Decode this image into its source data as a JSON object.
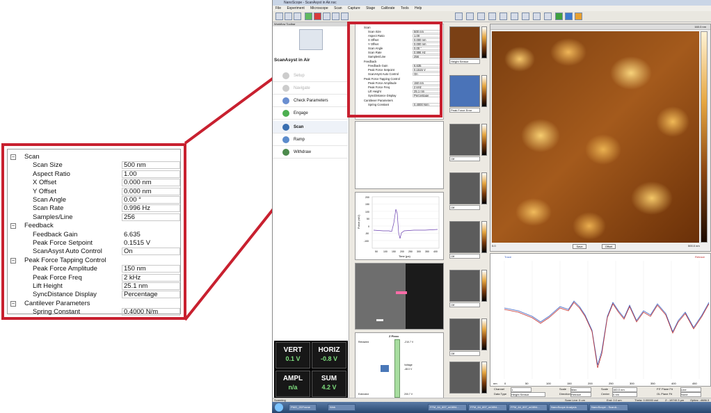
{
  "app": {
    "title": "NanoScope - ScanAsyst in Air.nsc",
    "menu": [
      "File",
      "Experiment",
      "Microscope",
      "Scan",
      "Capture",
      "Stage",
      "Calibrate",
      "Tools",
      "Help"
    ],
    "status": "Scanning"
  },
  "workflow": {
    "header": "Workflow Toolbar",
    "mode": "ScanAsyst in Air",
    "steps": [
      "Setup",
      "Navigate",
      "Check Parameters",
      "Engage",
      "Scan",
      "Ramp",
      "Withdraw"
    ]
  },
  "meters": {
    "vert": {
      "name": "VERT",
      "value": "0.1 V"
    },
    "horiz": {
      "name": "HORIZ",
      "value": "-0.8 V"
    },
    "ampl": {
      "name": "AMPL",
      "value": "n/a"
    },
    "sum": {
      "name": "SUM",
      "value": "4.2 V"
    }
  },
  "params": {
    "scan": {
      "title": "Scan",
      "scan_size": {
        "label": "Scan Size",
        "value": "500 nm"
      },
      "aspect_ratio": {
        "label": "Aspect Ratio",
        "value": "1.00"
      },
      "x_offset": {
        "label": "X Offset",
        "value": "0.000 nm"
      },
      "y_offset": {
        "label": "Y Offset",
        "value": "0.000 nm"
      },
      "scan_angle": {
        "label": "Scan Angle",
        "value": "0.00 °"
      },
      "scan_rate": {
        "label": "Scan Rate",
        "value": "0.996 Hz"
      },
      "samples_line": {
        "label": "Samples/Line",
        "value": "256"
      }
    },
    "feedback": {
      "title": "Feedback",
      "feedback_gain": {
        "label": "Feedback Gain",
        "value": "6.635"
      },
      "peak_force_setpoint": {
        "label": "Peak Force Setpoint",
        "value": "0.1515 V"
      },
      "scanasyst_auto": {
        "label": "ScanAsyst Auto Control",
        "value": "On"
      }
    },
    "pftc": {
      "title": "Peak Force Tapping Control",
      "amplitude": {
        "label": "Peak Force Amplitude",
        "value": "150 nm"
      },
      "freq": {
        "label": "Peak Force Freq",
        "value": "2 kHz"
      },
      "lift": {
        "label": "Lift Height",
        "value": "25.1 nm"
      },
      "sync": {
        "label": "SyncDistance Display",
        "value": "Percentage"
      }
    },
    "cantilever": {
      "title": "Cantilever Parameters",
      "spring": {
        "label": "Spring Constant",
        "value": "0.4000 N/m"
      }
    }
  },
  "force_plot": {
    "ylabel": "Force (mV)",
    "xlabel": "Time (µs)",
    "yticks": [
      "200",
      "150",
      "100",
      "50",
      "0",
      "-50",
      "-100"
    ],
    "xticks": [
      "50",
      "100",
      "150",
      "200",
      "250",
      "300",
      "350",
      "400"
    ]
  },
  "zpiezo": {
    "title": "Z Piezo",
    "retracted": "Retracted",
    "retracted_v": "-210.7 V",
    "voltage_label": "Voltage",
    "voltage": "-48.0 V",
    "extended": "Extended",
    "extended_v": "200.7 V"
  },
  "channels": {
    "ch1": "Height Sensor",
    "ch2": "Peak Force Error",
    "off": "Off",
    "scale_top": "160.0 nm",
    "scale_val": "1.000"
  },
  "main_image": {
    "scale": "160.0 nm",
    "x_start": "0.0",
    "x_end": "500.0 nm",
    "btn_save": "Save",
    "btn_offset": "Offset"
  },
  "profile": {
    "trace": "Trace",
    "retrace": "Retrace",
    "xaxis_unit": "nm",
    "xticks": [
      "0",
      "50",
      "100",
      "150",
      "200",
      "250",
      "300",
      "350",
      "400",
      "450"
    ],
    "channel_label": "Channel",
    "channel_value": "1",
    "scale_label": "Scale",
    "scale_value": "Man",
    "scale2_label": "Scale",
    "scale2_value": "160.0 nm",
    "fit_label": "FIT Plane Fit",
    "fit_value": "Line",
    "data_type_label": "Data Type",
    "data_type_value": "Height Sensor",
    "direction_label": "Direction",
    "direction_value": "Retrace",
    "center_label": "Center",
    "center_value": "0 nm",
    "ol_label": "OL Plane Fit",
    "ol_value": "None"
  },
  "statusbar": {
    "scan_line": "Scan Line: 0 um",
    "end_line": "End: 0.0 um",
    "theta": "Theta: 0.00000 rad",
    "z": "Z: -18740.3 µm",
    "optics": "Optics: -4686.3 µm"
  },
  "taskbar": [
    "PMG_2DFrame",
    "Web",
    "FFM_64_897_m0894...",
    "FFM_64_897_m0894...",
    "FFM_64_897_m0894...",
    "NanoScope Analysis",
    "NanoScope - ScanA..."
  ]
}
